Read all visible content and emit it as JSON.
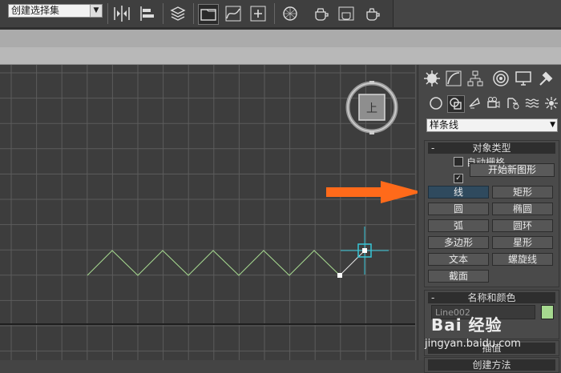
{
  "toolbar": {
    "named_selection": "创建选择集",
    "icons": [
      "mirror-icon",
      "align-icon",
      "layer-manager-icon",
      "scene-explorer-icon",
      "curve-editor-icon",
      "schematic-view-icon",
      "material-editor-icon",
      "render-setup-icon",
      "render-frame-icon",
      "render-icon"
    ]
  },
  "viewport": {
    "viewcube_label": "上",
    "spline_color": "#a6d98f",
    "grid_color": "#5c5c5c",
    "gizmo_color": "#36c6d8",
    "arrow_color": "#ff6a1a"
  },
  "command_panel": {
    "tabs": [
      "create-icon",
      "modify-icon",
      "hierarchy-icon",
      "motion-icon",
      "display-icon",
      "utilities-icon"
    ],
    "subtabs": [
      "geometry-icon",
      "shapes-icon",
      "lights-icon",
      "cameras-icon",
      "helpers-icon",
      "spacewarps-icon",
      "systems-icon"
    ],
    "category": "样条线",
    "object_type": {
      "header": "对象类型",
      "collapse": "-",
      "auto_grid": "自动栅格",
      "start_new_shape": "开始新图形",
      "start_checked": "✓",
      "buttons": [
        "线",
        "矩形",
        "圆",
        "椭圆",
        "弧",
        "圆环",
        "多边形",
        "星形",
        "文本",
        "螺旋线",
        "截面"
      ]
    },
    "name_color": {
      "header": "名称和颜色",
      "collapse": "-",
      "name_value": "Line002"
    },
    "interp_header": "插值",
    "creation_header": "创建方法"
  },
  "watermark": {
    "logo": "Bai 经验",
    "url": "jingyan.baidu.com"
  }
}
